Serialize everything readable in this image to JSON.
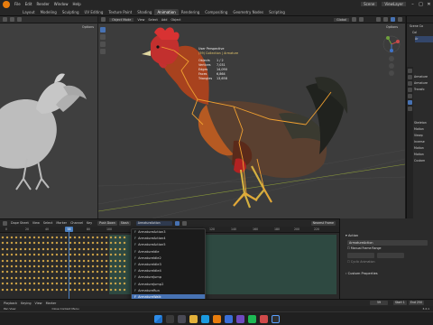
{
  "app": {
    "menu": [
      "File",
      "Edit",
      "Render",
      "Window",
      "Help"
    ],
    "workspaces": [
      "Layout",
      "Modeling",
      "Sculpting",
      "UV Editing",
      "Texture Paint",
      "Shading",
      "Animation",
      "Rendering",
      "Compositing",
      "Geometry Nodes",
      "Scripting"
    ],
    "active_workspace": "Animation",
    "scene_label": "Scene",
    "view_layer_label": "ViewLayer"
  },
  "viewport_main": {
    "mode": "Object Mode",
    "menus": [
      "View",
      "Select",
      "Add",
      "Object"
    ],
    "transform": "Global",
    "options_label": "Options",
    "stats": {
      "view": "User Perspective",
      "collection": "(59) Collection | Armature",
      "lines": [
        {
          "label": "Objects",
          "value": "1 / 2"
        },
        {
          "label": "Vertices",
          "value": "7,031"
        },
        {
          "label": "Edges",
          "value": "14,090"
        },
        {
          "label": "Faces",
          "value": "6,864"
        },
        {
          "label": "Triangles",
          "value": "13,658"
        }
      ]
    }
  },
  "viewport_left": {
    "options_label": "Options"
  },
  "outliner": {
    "items": [
      "Scene Co",
      "Col",
      "Ar"
    ]
  },
  "properties": {
    "rows": [
      "Armature",
      "Armature",
      "Transfo",
      "Skeleton",
      "Motion",
      "Viewp",
      "Inverse",
      "Motion",
      "Motion",
      "Custom"
    ]
  },
  "timeline": {
    "header_items": [
      "Dope Sheet",
      "View",
      "Select",
      "Marker",
      "Channel",
      "Key"
    ],
    "push_down": "Push Down",
    "stash": "Stash",
    "action_name": "ArmatureAction",
    "frame_ticks": [
      "0",
      "20",
      "40",
      "60",
      "80",
      "100",
      "120",
      "140",
      "160",
      "180",
      "200",
      "220",
      "240"
    ],
    "current_frame": "58",
    "nearest_frame": "Nearest Frame"
  },
  "dropdown": {
    "items": [
      "ArmatureAction3",
      "ArmatureAction4",
      "ArmatureAction5",
      "ArmatureIdle",
      "ArmatureIdle2",
      "ArmatureIdle3",
      "ArmatureIdle4",
      "ArmatureJump",
      "ArmatureJump2",
      "ArmatureRun",
      "ArmatureWalk"
    ],
    "selected_index": 10,
    "search_placeholder": ""
  },
  "side_panel": {
    "action_section": "Action",
    "action_field": "ArmatureAction",
    "manual_range": "Manual Frame Range",
    "cyclic": "Cyclic Animation",
    "custom_props": "Custom Properties"
  },
  "playbar": {
    "playback": "Playback",
    "keying": "Keying",
    "view": "View",
    "marker": "Marker",
    "frame": "59",
    "start_label": "Start",
    "start": "1",
    "end_label": "End",
    "end": "250"
  },
  "statusbar": {
    "left": "Pan View",
    "right": "Close Context Menu",
    "version": "3.2.1"
  },
  "colors": {
    "accent_blue": "#4772b3",
    "blender_orange": "#e87d0d",
    "keyframe": "#e8b64c",
    "bone": "#f0a030"
  }
}
